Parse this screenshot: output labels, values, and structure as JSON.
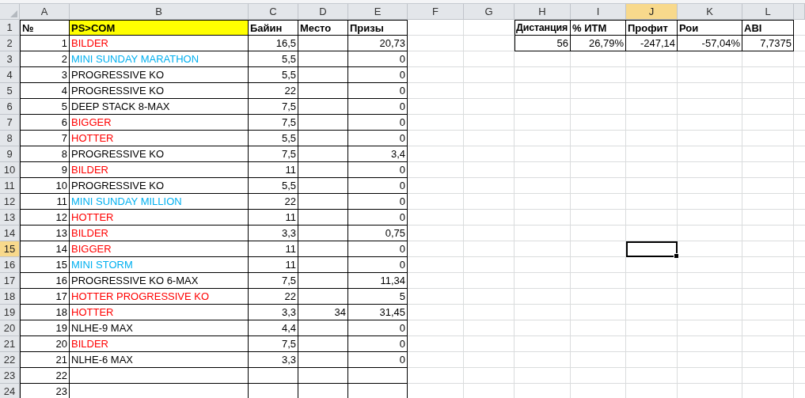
{
  "column_headers": [
    {
      "label": "A",
      "selected": false
    },
    {
      "label": "B",
      "selected": false
    },
    {
      "label": "C",
      "selected": false
    },
    {
      "label": "D",
      "selected": false
    },
    {
      "label": "E",
      "selected": false
    },
    {
      "label": "F",
      "selected": false
    },
    {
      "label": "G",
      "selected": false
    },
    {
      "label": "H",
      "selected": false
    },
    {
      "label": "I",
      "selected": false
    },
    {
      "label": "J",
      "selected": true
    },
    {
      "label": "K",
      "selected": false
    },
    {
      "label": "L",
      "selected": false
    }
  ],
  "row_headers": [
    {
      "label": "1",
      "selected": false
    },
    {
      "label": "2",
      "selected": false
    },
    {
      "label": "3",
      "selected": false
    },
    {
      "label": "4",
      "selected": false
    },
    {
      "label": "5",
      "selected": false
    },
    {
      "label": "6",
      "selected": false
    },
    {
      "label": "7",
      "selected": false
    },
    {
      "label": "8",
      "selected": false
    },
    {
      "label": "9",
      "selected": false
    },
    {
      "label": "10",
      "selected": false
    },
    {
      "label": "11",
      "selected": false
    },
    {
      "label": "12",
      "selected": false
    },
    {
      "label": "13",
      "selected": false
    },
    {
      "label": "14",
      "selected": false
    },
    {
      "label": "15",
      "selected": true
    },
    {
      "label": "16",
      "selected": false
    },
    {
      "label": "17",
      "selected": false
    },
    {
      "label": "18",
      "selected": false
    },
    {
      "label": "19",
      "selected": false
    },
    {
      "label": "20",
      "selected": false
    },
    {
      "label": "21",
      "selected": false
    },
    {
      "label": "22",
      "selected": false
    },
    {
      "label": "23",
      "selected": false
    },
    {
      "label": "24",
      "selected": false
    }
  ],
  "tournaments": {
    "columns": [
      "№",
      "PS>COM",
      "Байин",
      "Место",
      "Призы"
    ],
    "rows": [
      {
        "number": "1",
        "name": "BILDER",
        "color": "#ff0000",
        "buyin": "16,5",
        "prize": "20,73"
      },
      {
        "number": "2",
        "name": "MINI SUNDAY MARATHON",
        "color": "#00b0f0",
        "buyin": "5,5",
        "prize": "0"
      },
      {
        "number": "3",
        "name": "PROGRESSIVE KO",
        "color": "#000000",
        "buyin": "5,5",
        "prize": "0"
      },
      {
        "number": "4",
        "name": "PROGRESSIVE KO",
        "color": "#000000",
        "buyin": "22",
        "prize": "0"
      },
      {
        "number": "5",
        "name": "DEEP STACK 8-MAX",
        "color": "#000000",
        "buyin": "7,5",
        "prize": "0"
      },
      {
        "number": "6",
        "name": "BIGGER",
        "color": "#ff0000",
        "buyin": "7,5",
        "prize": "0"
      },
      {
        "number": "7",
        "name": "HOTTER",
        "color": "#ff0000",
        "buyin": "5,5",
        "prize": "0"
      },
      {
        "number": "8",
        "name": "PROGRESSIVE KO",
        "color": "#000000",
        "buyin": "7,5",
        "prize": "3,4"
      },
      {
        "number": "9",
        "name": "BILDER",
        "color": "#ff0000",
        "buyin": "11",
        "prize": "0"
      },
      {
        "number": "10",
        "name": "PROGRESSIVE KO",
        "color": "#000000",
        "buyin": "5,5",
        "prize": "0"
      },
      {
        "number": "11",
        "name": "MINI SUNDAY MILLION",
        "color": "#00b0f0",
        "buyin": "22",
        "prize": "0"
      },
      {
        "number": "12",
        "name": "HOTTER",
        "color": "#ff0000",
        "buyin": "11",
        "prize": "0"
      },
      {
        "number": "13",
        "name": "BILDER",
        "color": "#ff0000",
        "buyin": "3,3",
        "prize": "0,75"
      },
      {
        "number": "14",
        "name": "BIGGER",
        "color": "#ff0000",
        "buyin": "11",
        "prize": "0"
      },
      {
        "number": "15",
        "name": "MINI STORM",
        "color": "#00b0f0",
        "buyin": "11",
        "prize": "0"
      },
      {
        "number": "16",
        "name": "PROGRESSIVE KO 6-MAX",
        "color": "#000000",
        "buyin": "7,5",
        "prize": "11,34"
      },
      {
        "number": "17",
        "name": "HOTTER PROGRESSIVE KO",
        "color": "#ff0000",
        "buyin": "22",
        "prize": "5"
      },
      {
        "number": "18",
        "name": "HOTTER",
        "color": "#ff0000",
        "buyin": "3,3",
        "place": "34",
        "prize": "31,45"
      },
      {
        "number": "19",
        "name": "NLHE-9 MAX",
        "color": "#000000",
        "buyin": "4,4",
        "prize": "0"
      },
      {
        "number": "20",
        "name": "BILDER",
        "color": "#ff0000",
        "buyin": "7,5",
        "prize": "0"
      },
      {
        "number": "21",
        "name": "NLHE-6 MAX",
        "color": "#000000",
        "buyin": "3,3",
        "prize": "0"
      },
      {
        "number": "22"
      },
      {
        "number": "23"
      }
    ]
  },
  "summary": {
    "columns": [
      "Дистанция",
      "% ИТМ",
      "Профит",
      "Рои",
      "ABI"
    ],
    "values": [
      "56",
      "26,79%",
      "-247,14",
      "-57,04%",
      "7,7375"
    ]
  }
}
